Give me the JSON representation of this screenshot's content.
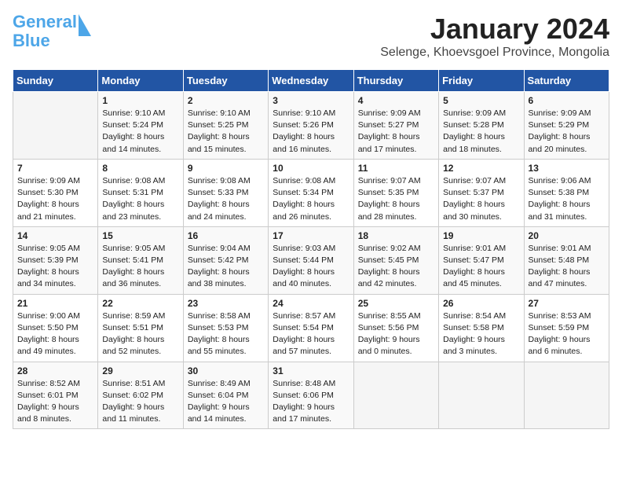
{
  "logo": {
    "line1": "General",
    "line2": "Blue"
  },
  "title": "January 2024",
  "subtitle": "Selenge, Khoevsgoel Province, Mongolia",
  "days_of_week": [
    "Sunday",
    "Monday",
    "Tuesday",
    "Wednesday",
    "Thursday",
    "Friday",
    "Saturday"
  ],
  "weeks": [
    [
      {
        "day": "",
        "content": ""
      },
      {
        "day": "1",
        "content": "Sunrise: 9:10 AM\nSunset: 5:24 PM\nDaylight: 8 hours\nand 14 minutes."
      },
      {
        "day": "2",
        "content": "Sunrise: 9:10 AM\nSunset: 5:25 PM\nDaylight: 8 hours\nand 15 minutes."
      },
      {
        "day": "3",
        "content": "Sunrise: 9:10 AM\nSunset: 5:26 PM\nDaylight: 8 hours\nand 16 minutes."
      },
      {
        "day": "4",
        "content": "Sunrise: 9:09 AM\nSunset: 5:27 PM\nDaylight: 8 hours\nand 17 minutes."
      },
      {
        "day": "5",
        "content": "Sunrise: 9:09 AM\nSunset: 5:28 PM\nDaylight: 8 hours\nand 18 minutes."
      },
      {
        "day": "6",
        "content": "Sunrise: 9:09 AM\nSunset: 5:29 PM\nDaylight: 8 hours\nand 20 minutes."
      }
    ],
    [
      {
        "day": "7",
        "content": "Sunrise: 9:09 AM\nSunset: 5:30 PM\nDaylight: 8 hours\nand 21 minutes."
      },
      {
        "day": "8",
        "content": "Sunrise: 9:08 AM\nSunset: 5:31 PM\nDaylight: 8 hours\nand 23 minutes."
      },
      {
        "day": "9",
        "content": "Sunrise: 9:08 AM\nSunset: 5:33 PM\nDaylight: 8 hours\nand 24 minutes."
      },
      {
        "day": "10",
        "content": "Sunrise: 9:08 AM\nSunset: 5:34 PM\nDaylight: 8 hours\nand 26 minutes."
      },
      {
        "day": "11",
        "content": "Sunrise: 9:07 AM\nSunset: 5:35 PM\nDaylight: 8 hours\nand 28 minutes."
      },
      {
        "day": "12",
        "content": "Sunrise: 9:07 AM\nSunset: 5:37 PM\nDaylight: 8 hours\nand 30 minutes."
      },
      {
        "day": "13",
        "content": "Sunrise: 9:06 AM\nSunset: 5:38 PM\nDaylight: 8 hours\nand 31 minutes."
      }
    ],
    [
      {
        "day": "14",
        "content": "Sunrise: 9:05 AM\nSunset: 5:39 PM\nDaylight: 8 hours\nand 34 minutes."
      },
      {
        "day": "15",
        "content": "Sunrise: 9:05 AM\nSunset: 5:41 PM\nDaylight: 8 hours\nand 36 minutes."
      },
      {
        "day": "16",
        "content": "Sunrise: 9:04 AM\nSunset: 5:42 PM\nDaylight: 8 hours\nand 38 minutes."
      },
      {
        "day": "17",
        "content": "Sunrise: 9:03 AM\nSunset: 5:44 PM\nDaylight: 8 hours\nand 40 minutes."
      },
      {
        "day": "18",
        "content": "Sunrise: 9:02 AM\nSunset: 5:45 PM\nDaylight: 8 hours\nand 42 minutes."
      },
      {
        "day": "19",
        "content": "Sunrise: 9:01 AM\nSunset: 5:47 PM\nDaylight: 8 hours\nand 45 minutes."
      },
      {
        "day": "20",
        "content": "Sunrise: 9:01 AM\nSunset: 5:48 PM\nDaylight: 8 hours\nand 47 minutes."
      }
    ],
    [
      {
        "day": "21",
        "content": "Sunrise: 9:00 AM\nSunset: 5:50 PM\nDaylight: 8 hours\nand 49 minutes."
      },
      {
        "day": "22",
        "content": "Sunrise: 8:59 AM\nSunset: 5:51 PM\nDaylight: 8 hours\nand 52 minutes."
      },
      {
        "day": "23",
        "content": "Sunrise: 8:58 AM\nSunset: 5:53 PM\nDaylight: 8 hours\nand 55 minutes."
      },
      {
        "day": "24",
        "content": "Sunrise: 8:57 AM\nSunset: 5:54 PM\nDaylight: 8 hours\nand 57 minutes."
      },
      {
        "day": "25",
        "content": "Sunrise: 8:55 AM\nSunset: 5:56 PM\nDaylight: 9 hours\nand 0 minutes."
      },
      {
        "day": "26",
        "content": "Sunrise: 8:54 AM\nSunset: 5:58 PM\nDaylight: 9 hours\nand 3 minutes."
      },
      {
        "day": "27",
        "content": "Sunrise: 8:53 AM\nSunset: 5:59 PM\nDaylight: 9 hours\nand 6 minutes."
      }
    ],
    [
      {
        "day": "28",
        "content": "Sunrise: 8:52 AM\nSunset: 6:01 PM\nDaylight: 9 hours\nand 8 minutes."
      },
      {
        "day": "29",
        "content": "Sunrise: 8:51 AM\nSunset: 6:02 PM\nDaylight: 9 hours\nand 11 minutes."
      },
      {
        "day": "30",
        "content": "Sunrise: 8:49 AM\nSunset: 6:04 PM\nDaylight: 9 hours\nand 14 minutes."
      },
      {
        "day": "31",
        "content": "Sunrise: 8:48 AM\nSunset: 6:06 PM\nDaylight: 9 hours\nand 17 minutes."
      },
      {
        "day": "",
        "content": ""
      },
      {
        "day": "",
        "content": ""
      },
      {
        "day": "",
        "content": ""
      }
    ]
  ]
}
